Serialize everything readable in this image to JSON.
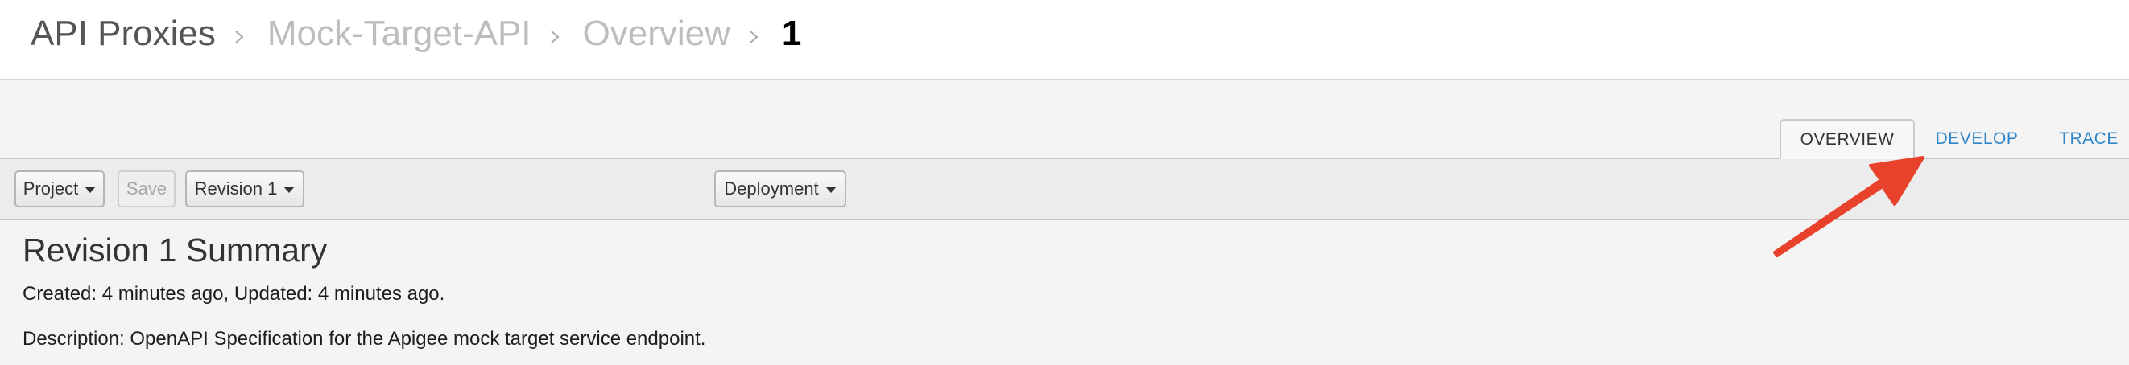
{
  "breadcrumb": {
    "items": [
      {
        "label": "API Proxies"
      },
      {
        "label": "Mock-Target-API"
      },
      {
        "label": "Overview"
      },
      {
        "label": "1"
      }
    ]
  },
  "tabs": [
    {
      "label": "OVERVIEW",
      "active": true
    },
    {
      "label": "DEVELOP",
      "active": false
    },
    {
      "label": "TRACE",
      "active": false
    }
  ],
  "toolbar": {
    "project_label": "Project",
    "save_label": "Save",
    "revision_label": "Revision 1",
    "deployment_label": "Deployment"
  },
  "summary": {
    "title": "Revision 1 Summary",
    "created_line": "Created: 4 minutes ago, Updated: 4 minutes ago.",
    "description_line": "Description: OpenAPI Specification for the Apigee mock target service endpoint."
  },
  "colors": {
    "link": "#2f86c9",
    "annotation_arrow": "#e8412c"
  },
  "icons": {
    "separator": "chevron-right-icon",
    "dropdown": "caret-down-icon",
    "annotation": "arrow-annotation"
  }
}
